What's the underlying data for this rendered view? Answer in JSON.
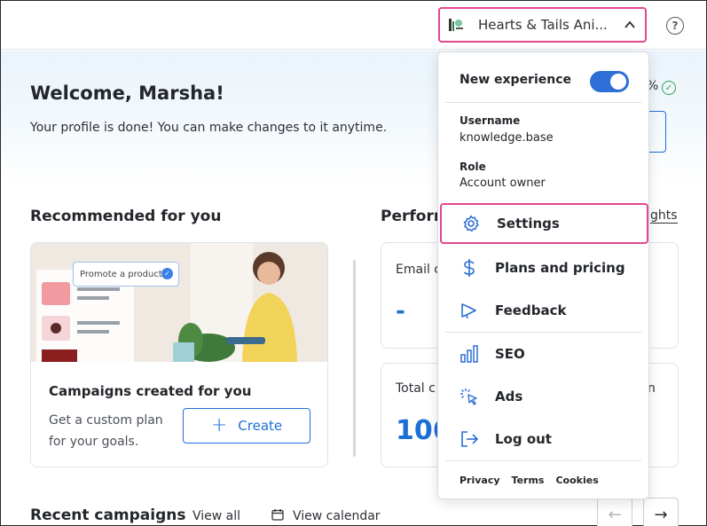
{
  "header": {
    "account_name": "Hearts & Tails Ani...",
    "help_glyph": "?"
  },
  "hero": {
    "title": "Welcome, Marsha!",
    "subtitle": "Your profile is done! You can make changes to it anytime.",
    "percent_fragment": "%"
  },
  "recommended": {
    "section_title": "Recommended for you",
    "card_chip": "Promote a product",
    "card_title": "Campaigns created for you",
    "card_desc": "Get a custom plan for your goals.",
    "create_label": "Create"
  },
  "performance": {
    "section_title_fragment": "Perform",
    "insights_fragment": "ghts",
    "email_label_fragment": "Email c",
    "email_value": "-",
    "total_label_fragment": "Total c",
    "total_value_fragment": "106",
    "total_right_fragment": "n"
  },
  "recent": {
    "title": "Recent campaigns",
    "view_all": "View all",
    "view_calendar": "View calendar"
  },
  "dropdown": {
    "new_experience_label": "New experience",
    "new_experience_on": true,
    "username_label": "Username",
    "username_value": "knowledge.base",
    "role_label": "Role",
    "role_value": "Account owner",
    "menu": [
      {
        "label": "Settings",
        "icon": "gear-icon"
      },
      {
        "label": "Plans and pricing",
        "icon": "dollar-icon"
      },
      {
        "label": "Feedback",
        "icon": "megaphone-icon"
      },
      {
        "label": "SEO",
        "icon": "bar-chart-icon"
      },
      {
        "label": "Ads",
        "icon": "cursor-click-icon"
      },
      {
        "label": "Log out",
        "icon": "logout-icon"
      }
    ],
    "footer": {
      "privacy": "Privacy",
      "terms": "Terms",
      "cookies": "Cookies"
    }
  },
  "colors": {
    "accent_blue": "#1d6fd6",
    "highlight_pink": "#e2478f",
    "success_green": "#2ea44f"
  }
}
